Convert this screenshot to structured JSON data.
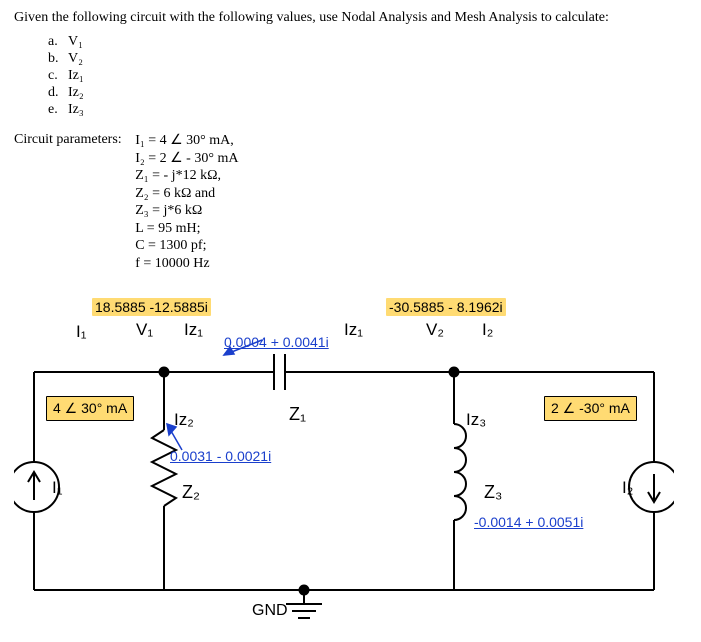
{
  "intro": "Given the following circuit with the following values, use Nodal Analysis and Mesh Analysis to calculate:",
  "list": {
    "a": {
      "m": "a.",
      "t": "V₁"
    },
    "b": {
      "m": "b.",
      "t": "V₂"
    },
    "c": {
      "m": "c.",
      "t": "Iᴢ₁"
    },
    "d": {
      "m": "d.",
      "t": "Iᴢ₂"
    },
    "e": {
      "m": "e.",
      "t": "Iᴢ₃"
    }
  },
  "params": {
    "label": "Circuit parameters:",
    "l1": "I₁ = 4 ∠ 30° mA,",
    "l2": "I₂ = 2 ∠ - 30° mA",
    "l3": "Z₁ = - j*12 kΩ,",
    "l4": "Z₂ = 6 kΩ and",
    "l5": "Z₃ = j*6 kΩ",
    "l6": "L = 95 mH;",
    "l7": "C = 1300 pf;",
    "l8": "f = 10000 Hz"
  },
  "circ": {
    "node_v1": "18.5885 -12.5885i",
    "node_v2": "-30.5885 - 8.1962i",
    "i1_top": "I₁",
    "v1": "V₁",
    "iz1": "Iz₁",
    "z1_val": "0.0004 + 0.0041i",
    "iz1_r": "Iz₁",
    "v2": "V₂",
    "i2_top": "I₂",
    "src1_box": "4 ∠ 30° mA",
    "src2_box": "2 ∠ -30° mA",
    "iz2": "Iz₂",
    "z2_val": "0.0031 - 0.0021i",
    "i1_side": "I₁",
    "z2": "Z₂",
    "z1": "Z₁",
    "iz3": "Iz₃",
    "z3": "Z₃",
    "z3_val": "-0.0014 + 0.0051i",
    "i2_side": "I₂",
    "gnd": "GND"
  }
}
